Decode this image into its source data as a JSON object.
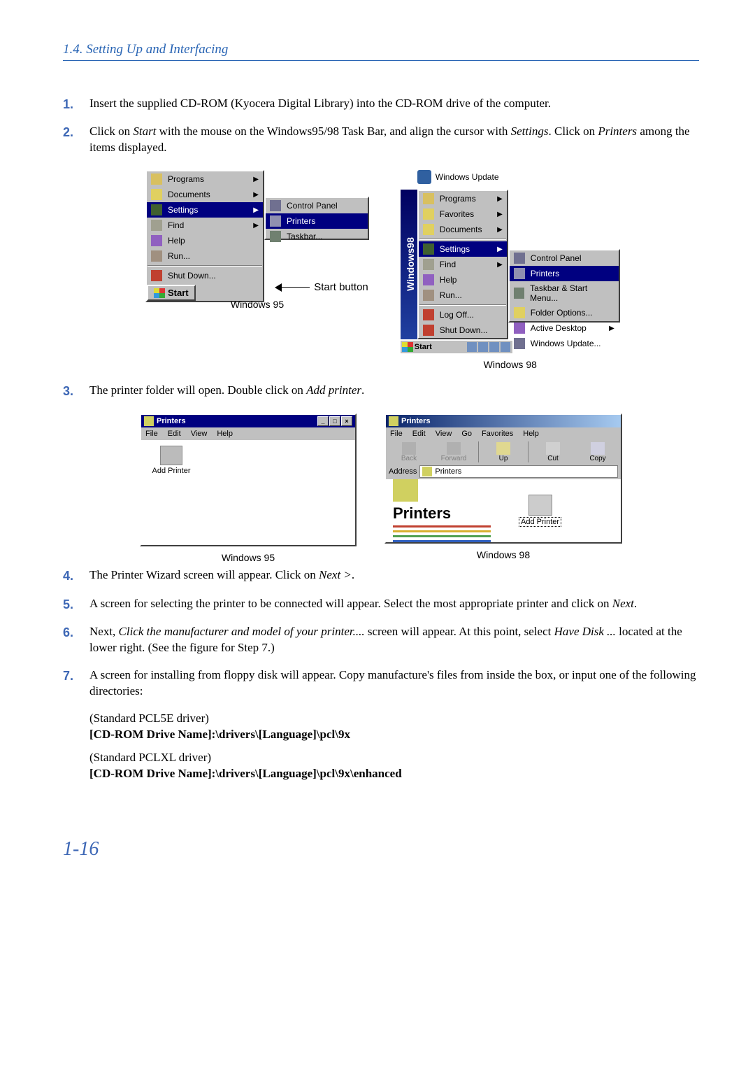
{
  "header": {
    "section_title": "1.4. Setting Up and Interfacing"
  },
  "steps": {
    "s1": "Insert the supplied CD-ROM (Kyocera Digital Library) into the CD-ROM drive of the computer.",
    "s2a": "Click on ",
    "s2_start": "Start",
    "s2b": " with the mouse on the Windows95/98 Task Bar, and align the cursor with ",
    "s2_settings": "Settings",
    "s2c": ". Click on ",
    "s2_printers": "Printers",
    "s2d": " among the items displayed.",
    "s3a": "The printer folder will open.  Double click on ",
    "s3_add": "Add printer",
    "s3b": ".",
    "s4a": "The Printer Wizard screen will appear.  Click on ",
    "s4_next": "Next >",
    "s4b": ".",
    "s5a": "A screen for selecting the printer to be connected will appear.  Select the most appropriate printer and click on ",
    "s5_next": "Next",
    "s5b": ".",
    "s6a": "Next, ",
    "s6_em": "Click the manufacturer and model of your printer....",
    "s6b": " screen will appear.  At this point, select ",
    "s6_have": "Have Disk ...",
    "s6c": " located at the lower right.  (See the figure for Step 7.)",
    "s7": "A screen for installing from floppy disk will appear. Copy manufacture's files from inside the box, or input one of the following directories:"
  },
  "captions": {
    "start_button": "Start button",
    "win95": "Windows 95",
    "win98": "Windows 98"
  },
  "win95menu": {
    "programs": "Programs",
    "documents": "Documents",
    "settings": "Settings",
    "find": "Find",
    "help": "Help",
    "run": "Run...",
    "shutdown": "Shut Down...",
    "start": "Start",
    "cpanel": "Control Panel",
    "printers": "Printers",
    "taskbar": "Taskbar..."
  },
  "win98menu": {
    "windows_update": "Windows Update",
    "programs": "Programs",
    "favorites": "Favorites",
    "documents": "Documents",
    "settings": "Settings",
    "find": "Find",
    "help": "Help",
    "run": "Run...",
    "logoff": "Log Off...",
    "shutdown": "Shut Down...",
    "banner": "Windows98",
    "start": "Start",
    "cpanel": "Control Panel",
    "printers": "Printers",
    "taskbar": "Taskbar & Start Menu...",
    "folder_options": "Folder Options...",
    "active_desktop": "Active Desktop",
    "windows_update2": "Windows Update..."
  },
  "printers_win": {
    "title": "Printers",
    "file": "File",
    "edit": "Edit",
    "view": "View",
    "help": "Help",
    "go": "Go",
    "favorites": "Favorites",
    "add_printer": "Add Printer",
    "back": "Back",
    "forward": "Forward",
    "up": "Up",
    "cut": "Cut",
    "copy": "Copy",
    "address": "Address",
    "printers_big": "Printers"
  },
  "drivers": {
    "pcl5e_label": "(Standard PCL5E driver)",
    "pcl5e_path": "[CD-ROM Drive Name]:\\drivers\\[Language]\\pcl\\9x",
    "pclxl_label": "(Standard PCLXL driver)",
    "pclxl_path": "[CD-ROM Drive Name]:\\drivers\\[Language]\\pcl\\9x\\enhanced"
  },
  "page_number": "1-16"
}
